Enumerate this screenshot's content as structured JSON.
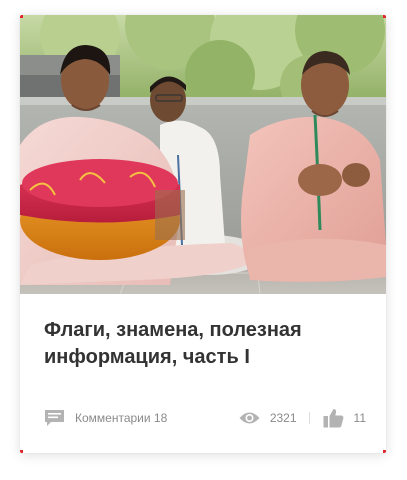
{
  "card": {
    "title": "Флаги, знамена, полезная информация, часть I",
    "comments_label": "Комментарии 18",
    "views": "2321",
    "likes": "11",
    "accent_color": "#e0252d",
    "icon_color": "#b3b3b3"
  },
  "photo": {
    "icons": [
      "photo-image"
    ]
  }
}
